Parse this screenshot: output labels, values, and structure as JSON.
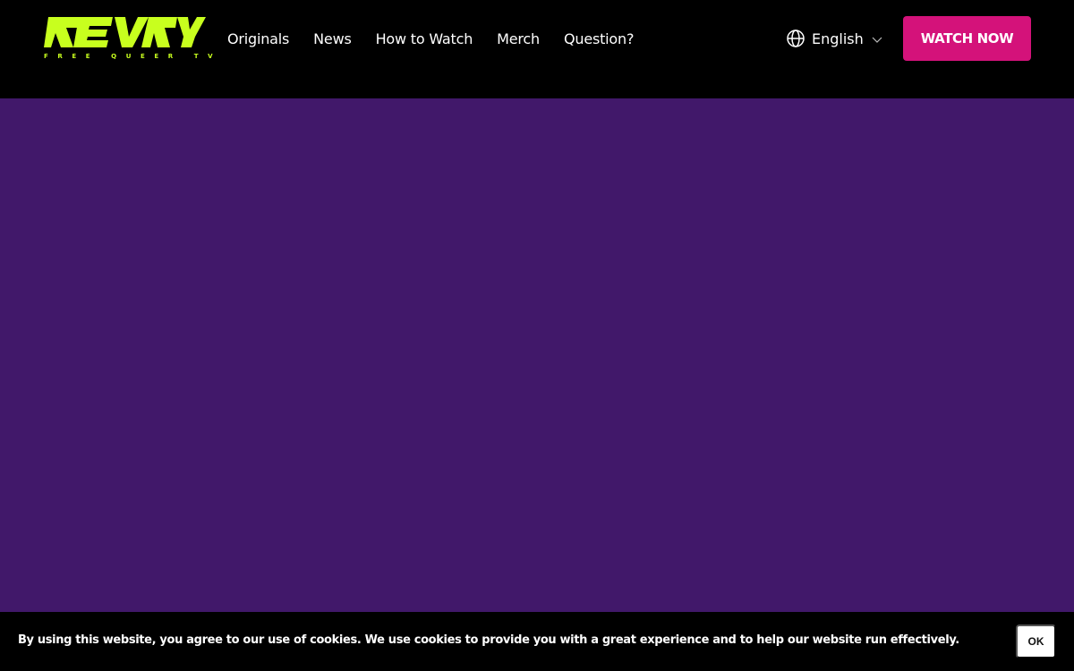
{
  "brand": {
    "logo_text": "REVRY",
    "tagline": "FREE QUEER TV",
    "logo_color": "#c8ff1e"
  },
  "nav": {
    "items": [
      {
        "label": "Originals"
      },
      {
        "label": "News"
      },
      {
        "label": "How to Watch"
      },
      {
        "label": "Merch"
      },
      {
        "label": "Question?"
      }
    ]
  },
  "language": {
    "selected": "English",
    "icon": "globe-icon",
    "dropdown_icon": "chevron-down-icon"
  },
  "cta": {
    "label": "WATCH NOW",
    "color": "#d4127a"
  },
  "hero": {
    "background": "#41186a"
  },
  "cookie_banner": {
    "message": "By using this website, you agree to our use of cookies. We use cookies to provide you with a great experience and to help our website run effectively.",
    "ok_label": "OK"
  }
}
